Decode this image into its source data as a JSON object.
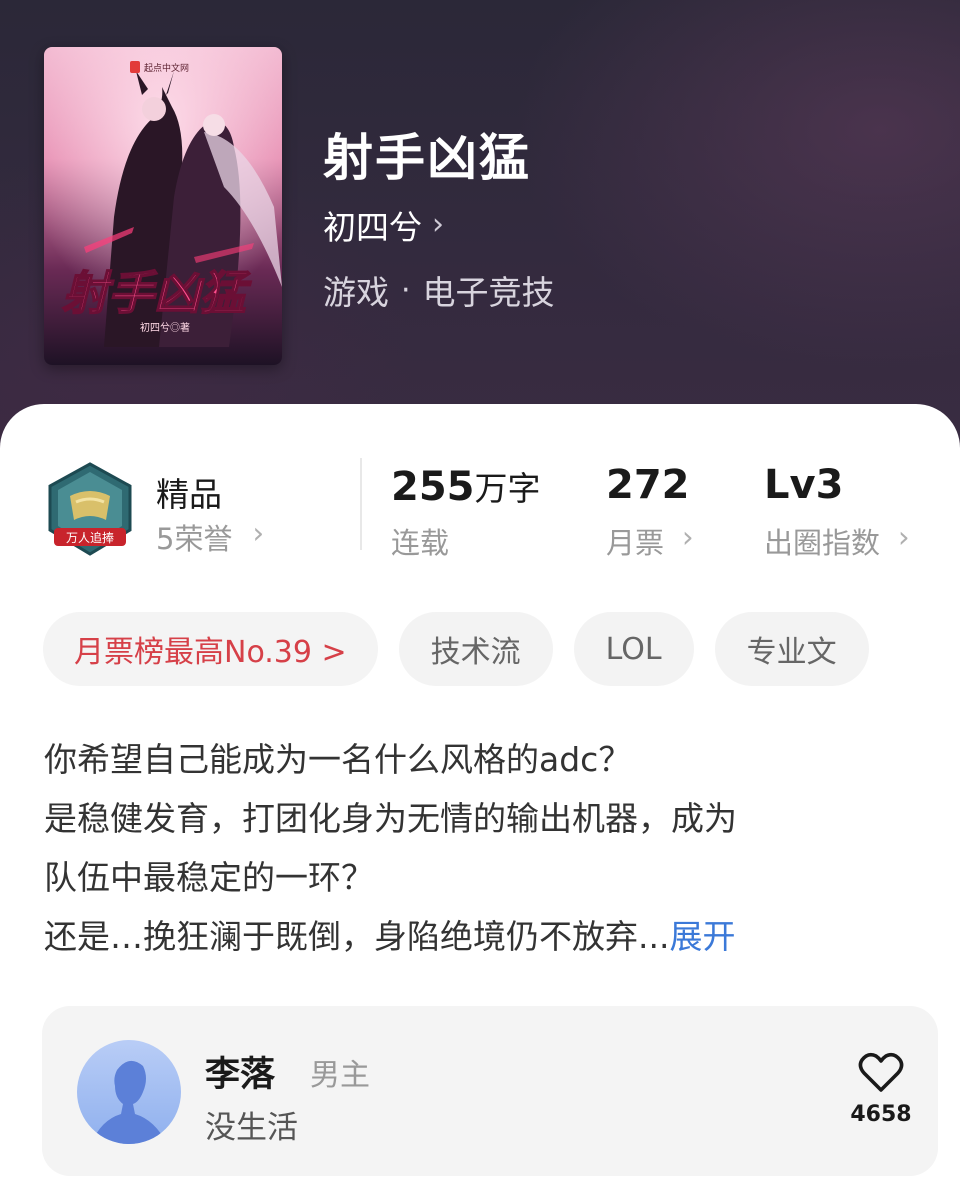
{
  "book": {
    "title": "射手凶猛",
    "author": "初四兮",
    "genre_primary": "游戏",
    "genre_separator": "·",
    "genre_secondary": "电子竞技",
    "cover": {
      "publisher_logo": "起点中文网",
      "title_art": "射手凶猛",
      "author_credit": "初四兮◎著"
    }
  },
  "stats": {
    "tier_label": "精品",
    "honor_label": "5荣誉",
    "badge_text": "万人追捧",
    "word_count": "255",
    "word_unit": "万字",
    "word_status": "连载",
    "monthly_tickets": "272",
    "monthly_tickets_label": "月票",
    "level": "Lv3",
    "level_label": "出圈指数"
  },
  "tags": [
    "月票榜最高No.39 >",
    "技术流",
    "LOL",
    "专业文"
  ],
  "description": {
    "lines": [
      "你希望自己能成为一名什么风格的adc？",
      "是稳健发育，打团化身为无情的输出机器，成为",
      "队伍中最稳定的一环？",
      "还是…挽狂澜于既倒，身陷绝境仍不放弃..."
    ],
    "expand_label": "展开"
  },
  "character": {
    "name": "李落",
    "role": "男主",
    "motto": "没生活",
    "likes": "4658"
  },
  "colors": {
    "header_bg": "#2b2838",
    "rank_tag": "#d64048",
    "expand_link": "#3b79d8"
  },
  "icons": {
    "chevron": "chevron-right-icon",
    "like": "heart-outline-icon",
    "badge": "quality-badge-icon"
  }
}
